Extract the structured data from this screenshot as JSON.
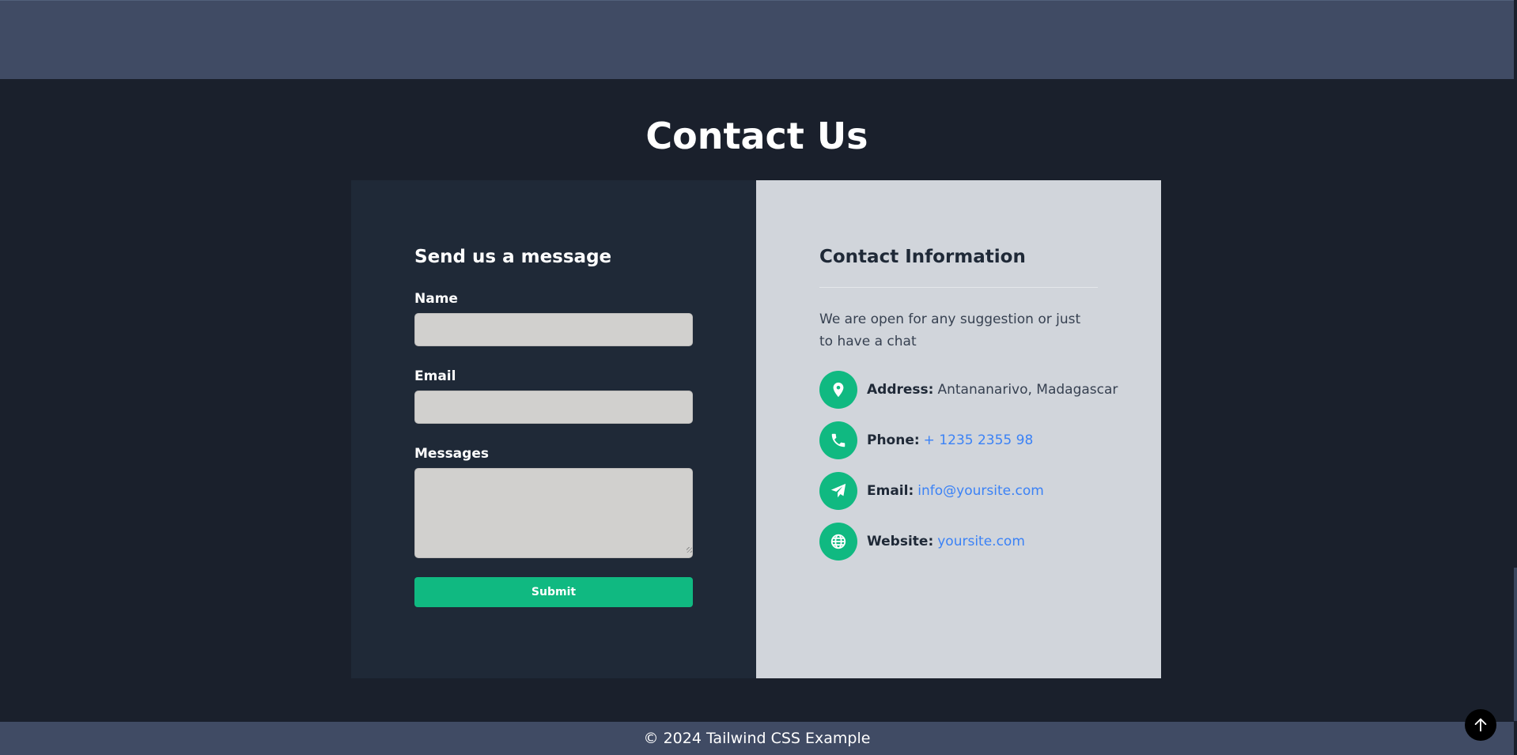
{
  "page": {
    "title": "Contact Us"
  },
  "form": {
    "heading": "Send us a message",
    "name_label": "Name",
    "name_value": "",
    "email_label": "Email",
    "email_value": "",
    "messages_label": "Messages",
    "messages_value": "",
    "submit_label": "Submit"
  },
  "contact_info": {
    "heading": "Contact Information",
    "description": "We are open for any suggestion or just to have a chat",
    "rows": [
      {
        "icon": "map-pin-icon",
        "label": "Address:",
        "value": "Antananarivo, Madagascar"
      },
      {
        "icon": "phone-icon",
        "label": "Phone:",
        "value": "+ 1235 2355 98"
      },
      {
        "icon": "paper-plane-icon",
        "label": "Email:",
        "value": "info@yoursite.com"
      },
      {
        "icon": "globe-icon",
        "label": "Website:",
        "value": "yoursite.com"
      }
    ]
  },
  "footer": {
    "text": "© 2024 Tailwind CSS Example"
  },
  "back_to_top": {
    "icon": "arrow-up-icon"
  },
  "colors": {
    "background": "#1a202c",
    "header_footer": "#404b64",
    "form_panel": "#1f2937",
    "info_panel": "#d1d5db",
    "accent_green": "#10b981",
    "link_blue": "#3b82f6",
    "input_bg": "#d1d0ce"
  }
}
